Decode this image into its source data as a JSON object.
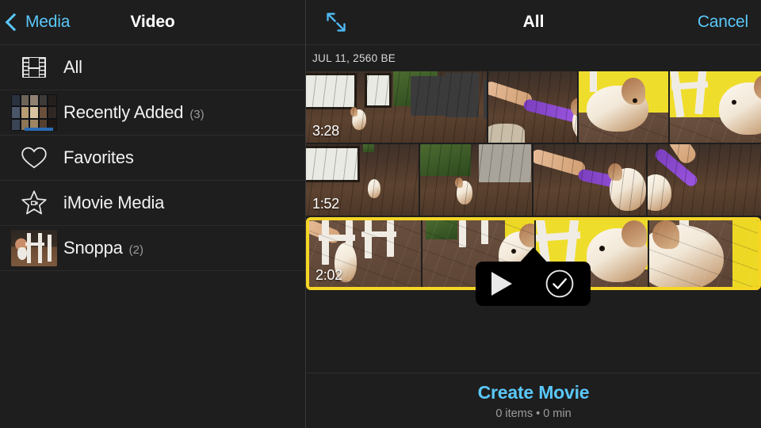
{
  "sidebar": {
    "back_label": "Media",
    "back_icon": "chevron-left-icon",
    "title": "Video",
    "items": [
      {
        "label": "All",
        "count": "",
        "icon": "filmstrip-icon"
      },
      {
        "label": "Recently Added",
        "count": "(3)",
        "icon": "recent-collage-thumbnail"
      },
      {
        "label": "Favorites",
        "count": "",
        "icon": "heart-icon"
      },
      {
        "label": "iMovie Media",
        "count": "",
        "icon": "imovie-star-icon"
      },
      {
        "label": "Snoppa",
        "count": "(2)",
        "icon": "album-photo-thumbnail"
      }
    ]
  },
  "main": {
    "expand_icon": "expand-diagonal-arrows-icon",
    "title": "All",
    "cancel_label": "Cancel",
    "date_header": "JUL 11, 2560 BE",
    "rows": [
      {
        "duration": "3:28",
        "selected": false
      },
      {
        "duration": "1:52",
        "selected": false
      },
      {
        "duration": "2:02",
        "selected": true
      }
    ]
  },
  "popup": {
    "play_icon": "play-icon",
    "select_icon": "checkmark-circle-icon"
  },
  "footer": {
    "create_label": "Create Movie",
    "summary": "0 items • 0 min"
  },
  "colors": {
    "accent_blue": "#5ac8fa",
    "selection_yellow": "#f5d625",
    "background": "#1e1e1e",
    "popup_black": "#000000",
    "text_primary": "#ffffff",
    "text_secondary": "#9a9a9a"
  }
}
